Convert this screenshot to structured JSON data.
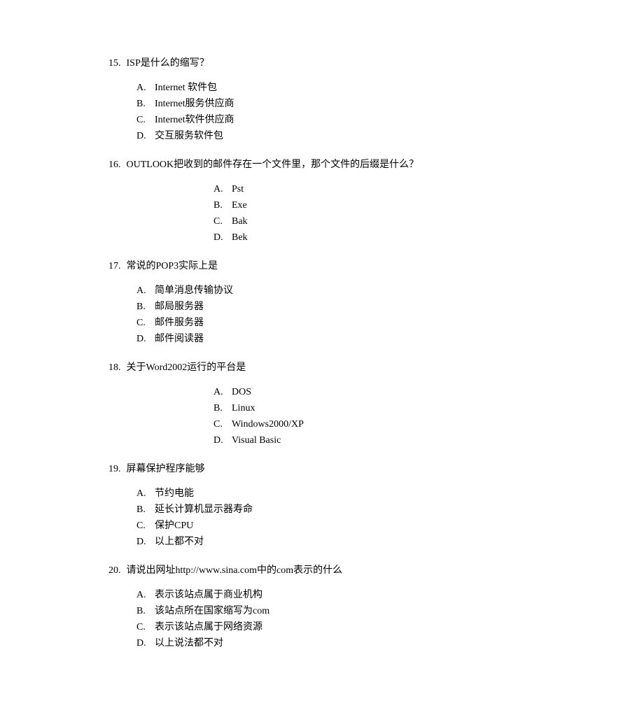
{
  "questions": [
    {
      "number": "15.",
      "text": "ISP是什么的缩写？",
      "centered": false,
      "options": [
        {
          "label": "A.",
          "text": "Internet 软件包"
        },
        {
          "label": "B.",
          "text": "Internet服务供应商"
        },
        {
          "label": "C.",
          "text": "Internet软件供应商"
        },
        {
          "label": "D.",
          "text": "交互服务软件包"
        }
      ]
    },
    {
      "number": "16.",
      "text": "OUTLOOK把收到的邮件存在一个文件里，那个文件的后缀是什么？",
      "centered": true,
      "options": [
        {
          "label": "A.",
          "text": "Pst"
        },
        {
          "label": "B.",
          "text": "Exe"
        },
        {
          "label": "C.",
          "text": "Bak"
        },
        {
          "label": "D.",
          "text": "Bek"
        }
      ]
    },
    {
      "number": "17.",
      "text": "常说的POP3实际上是",
      "centered": false,
      "options": [
        {
          "label": "A.",
          "text": "简单消息传输协议"
        },
        {
          "label": "B.",
          "text": "邮局服务器"
        },
        {
          "label": "C.",
          "text": "邮件服务器"
        },
        {
          "label": "D.",
          "text": "邮件阅读器"
        }
      ]
    },
    {
      "number": "18.",
      "text": "关于Word2002运行的平台是",
      "centered": true,
      "options": [
        {
          "label": "A.",
          "text": "DOS"
        },
        {
          "label": "B.",
          "text": "Linux"
        },
        {
          "label": "C.",
          "text": "Windows2000/XP"
        },
        {
          "label": "D.",
          "text": "Visual Basic"
        }
      ]
    },
    {
      "number": "19.",
      "text": "屏幕保护程序能够",
      "centered": false,
      "options": [
        {
          "label": "A.",
          "text": "节约电能"
        },
        {
          "label": "B.",
          "text": "延长计算机显示器寿命"
        },
        {
          "label": "C.",
          "text": "保护CPU"
        },
        {
          "label": "D.",
          "text": "以上都不对"
        }
      ]
    },
    {
      "number": "20.",
      "text": "请说出网址http://www.sina.com中的com表示的什么",
      "centered": false,
      "options": [
        {
          "label": "A.",
          "text": "表示该站点属于商业机构"
        },
        {
          "label": "B.",
          "text": "该站点所在国家缩写为com"
        },
        {
          "label": "C.",
          "text": "表示该站点属于网络资源"
        },
        {
          "label": "D.",
          "text": "以上说法都不对"
        }
      ]
    }
  ]
}
